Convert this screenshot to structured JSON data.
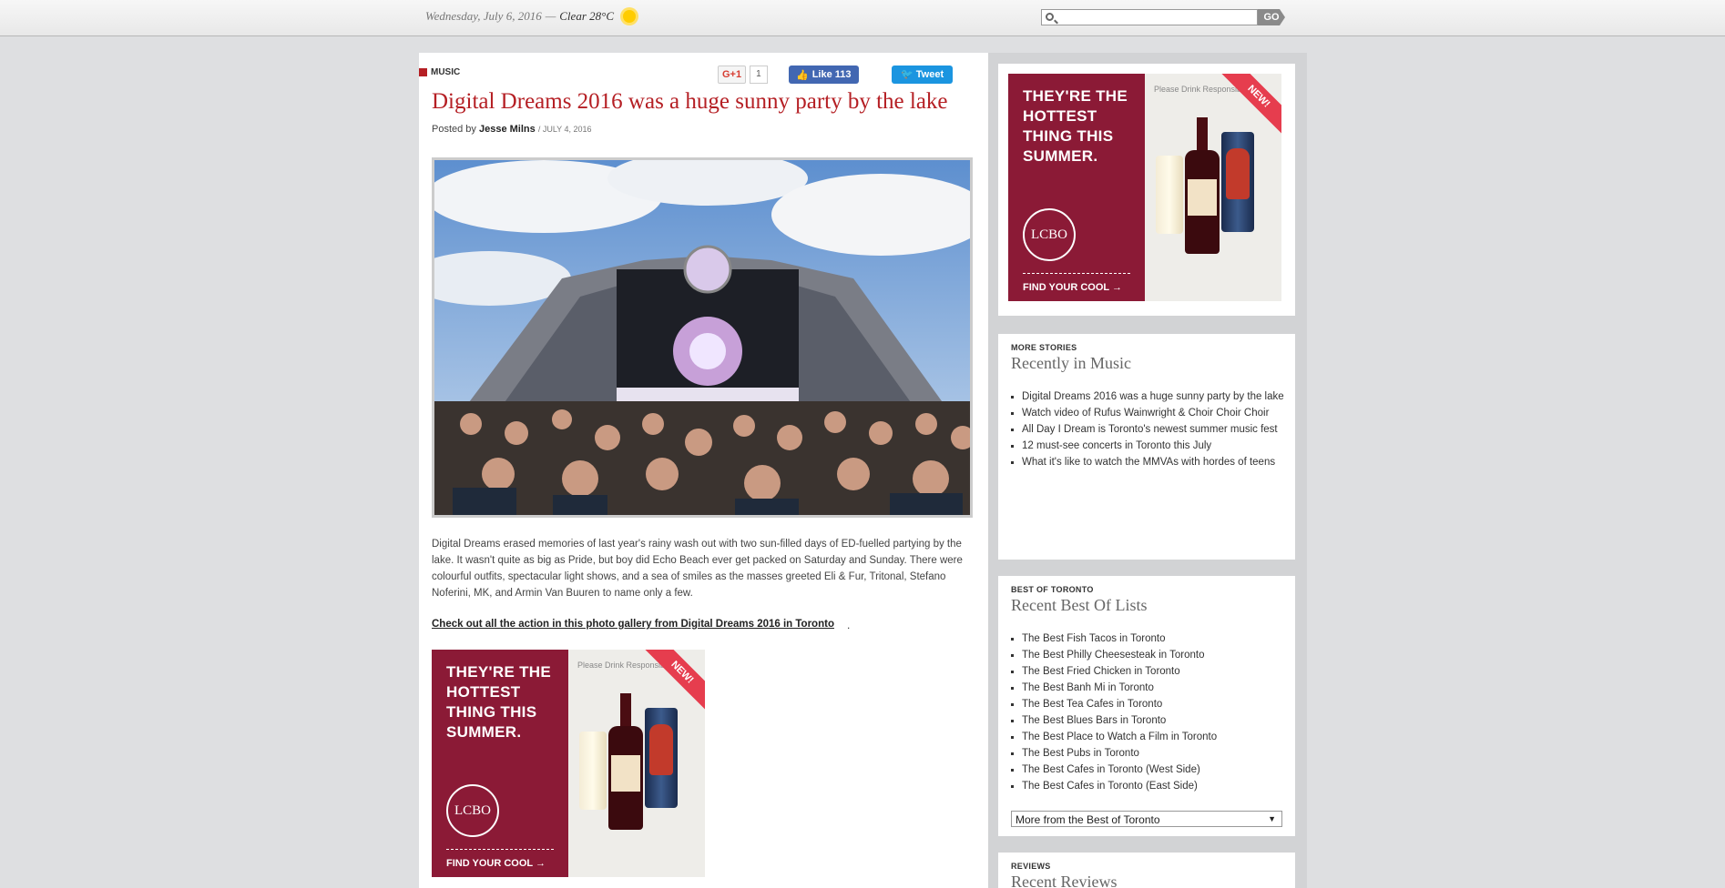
{
  "topbar": {
    "date": "Wednesday, July 6, 2016",
    "separator": "—",
    "weather": "Clear 28°C",
    "search_placeholder": "",
    "go_label": "GO"
  },
  "article": {
    "category": "MUSIC",
    "gplus_label": "G+1",
    "gplus_count": "1",
    "fb_label": "Like 113",
    "tweet_label": "Tweet",
    "title": "Digital Dreams 2016 was a huge sunny party by the lake",
    "posted_by": "Posted by",
    "author": "Jesse Milns",
    "date": "/ JULY 4, 2016",
    "body": "Digital Dreams erased memories of last year's rainy wash out with two sun-filled days of ED-fuelled partying by the lake. It wasn't quite as big as Pride, but boy did Echo Beach ever get packed on Saturday and Sunday. There were colourful outfits, spectacular light shows, and a sea of smiles as the masses greeted Eli & Fur, Tritonal, Stefano Noferini, MK, and Armin Van Buuren to name only a few.",
    "gallery_link": "Check out all the action in this photo gallery from Digital Dreams 2016 in Toronto",
    "gallery_period": "."
  },
  "ad": {
    "headline": "THEY'RE THE HOTTEST THING THIS SUMMER.",
    "logo": "LCBO",
    "cta": "FIND YOUR COOL →",
    "disclaimer": "Please Drink Responsibly.",
    "badge": "NEW!"
  },
  "more_stories": {
    "kicker": "MORE STORIES",
    "title": "Recently in Music",
    "items": [
      "Digital Dreams 2016 was a huge sunny party by the lake",
      "Watch video of Rufus Wainwright & Choir Choir Choir",
      "All Day I Dream is Toronto's newest summer music fest",
      "12 must-see concerts in Toronto this July",
      "What it's like to watch the MMVAs with hordes of teens"
    ]
  },
  "best_of": {
    "kicker": "BEST OF TORONTO",
    "title": "Recent Best Of Lists",
    "items": [
      "The Best Fish Tacos in Toronto",
      "The Best Philly Cheesesteak in Toronto",
      "The Best Fried Chicken in Toronto",
      "The Best Banh Mi in Toronto",
      "The Best Tea Cafes in Toronto",
      "The Best Blues Bars in Toronto",
      "The Best Place to Watch a Film in Toronto",
      "The Best Pubs in Toronto",
      "The Best Cafes in Toronto (West Side)",
      "The Best Cafes in Toronto (East Side)"
    ],
    "select_value": "More from the Best of Toronto"
  },
  "reviews": {
    "kicker": "REVIEWS",
    "title": "Recent Reviews"
  }
}
